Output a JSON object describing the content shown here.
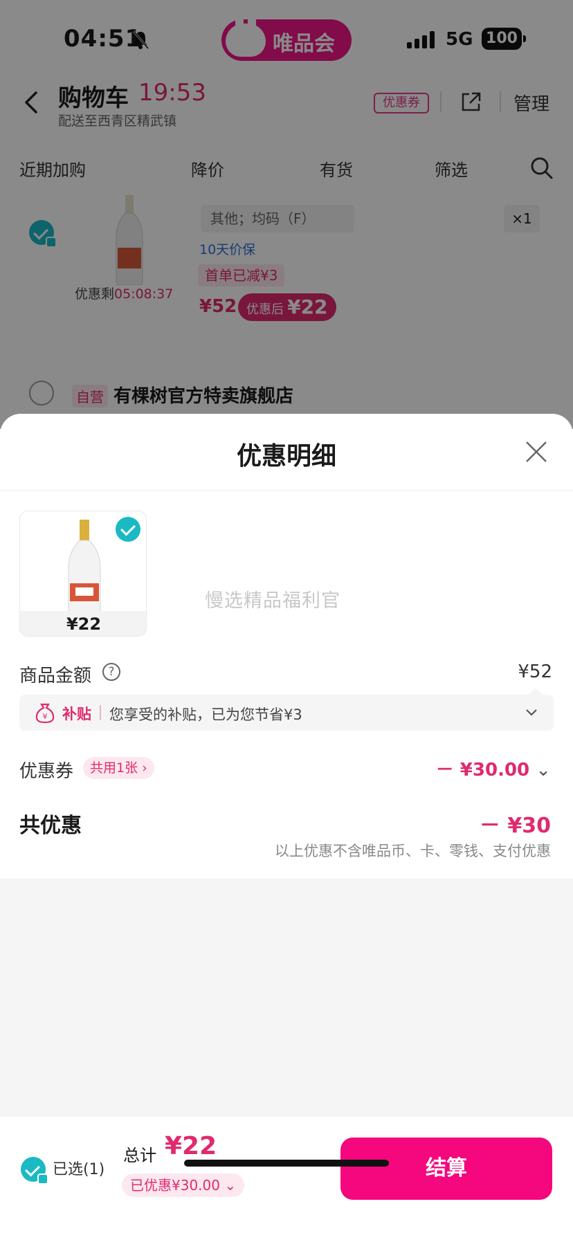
{
  "status_bar": {
    "time": "04:51",
    "network": "5G",
    "battery": "100"
  },
  "app_badge": {
    "name": "唯品会"
  },
  "cart_header": {
    "title": "购物车",
    "timer": "19:53",
    "address": "配送至西青区精武镇",
    "coupon_tag": "优惠券",
    "manage": "管理"
  },
  "filters": [
    "近期加购",
    "降价",
    "有货",
    "筛选"
  ],
  "cart_item": {
    "sku": "其他；均码（F）",
    "qty": "×1",
    "protect": "10天价保",
    "first_order": "首单已减¥3",
    "countdown_label": "优惠剩",
    "countdown_time": "05:08:37",
    "price": "¥52",
    "after_label": "优惠后",
    "after_price": "¥22"
  },
  "store": {
    "tag": "自营",
    "name": "有棵树官方特卖旗舰店"
  },
  "sheet": {
    "title": "优惠明细",
    "product_price": "¥22",
    "watermark": "慢选精品福利官",
    "amount_label": "商品金额",
    "amount_value": "¥52",
    "subsidy_tag": "补贴",
    "subsidy_text": "您享受的补贴，已为您节省¥3",
    "coupon_label": "优惠券",
    "coupon_pill": "共用1张",
    "coupon_value": "－ ¥30.00",
    "total_label": "共优惠",
    "total_value": "－ ¥30",
    "total_note": "以上优惠不含唯品币、卡、零钱、支付优惠"
  },
  "bottom_bar": {
    "selected": "已选(1)",
    "total_label": "总计",
    "total_value": "¥22",
    "saved": "已优惠¥30.00",
    "checkout": "结算"
  },
  "colors": {
    "accent": "#f5077d",
    "price": "#e02a6f",
    "check": "#1ab9c4"
  }
}
